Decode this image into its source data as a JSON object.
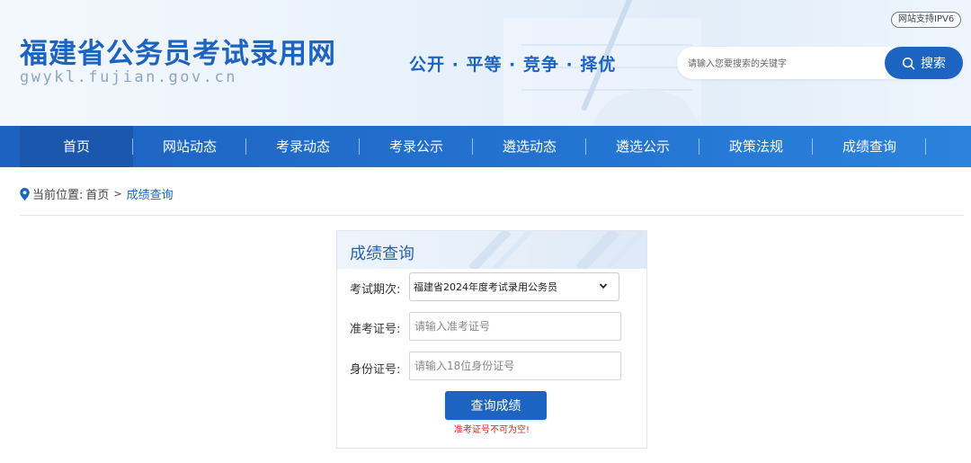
{
  "header": {
    "site_title": "福建省公务员考试录用网",
    "site_domain": "gwykl.fujian.gov.cn",
    "slogan": "公开 · 平等 · 竞争 · 择优",
    "ipv6_badge": "网站支持IPV6",
    "search": {
      "placeholder": "请输入您要搜索的关键字",
      "button_label": "搜索"
    }
  },
  "nav": {
    "items": [
      {
        "label": "首页",
        "active": true
      },
      {
        "label": "网站动态"
      },
      {
        "label": "考录动态"
      },
      {
        "label": "考录公示"
      },
      {
        "label": "遴选动态"
      },
      {
        "label": "遴选公示"
      },
      {
        "label": "政策法规"
      },
      {
        "label": "成绩查询"
      }
    ]
  },
  "breadcrumb": {
    "prefix": "当前位置:",
    "home": "首页",
    "separator": ">",
    "current": "成绩查询"
  },
  "form": {
    "title": "成绩查询",
    "exam_label": "考试期次:",
    "exam_selected": "福建省2024年度考试录用公务员",
    "ticket_label": "准考证号:",
    "ticket_placeholder": "请输入准考证号",
    "id_label": "身份证号:",
    "id_placeholder": "请输入18位身份证号",
    "submit_label": "查询成绩",
    "error_message": "准考证号不可为空!"
  },
  "colors": {
    "brand_blue": "#1d64c2",
    "nav_blue": "#2474d2",
    "error_red": "#e02020"
  }
}
